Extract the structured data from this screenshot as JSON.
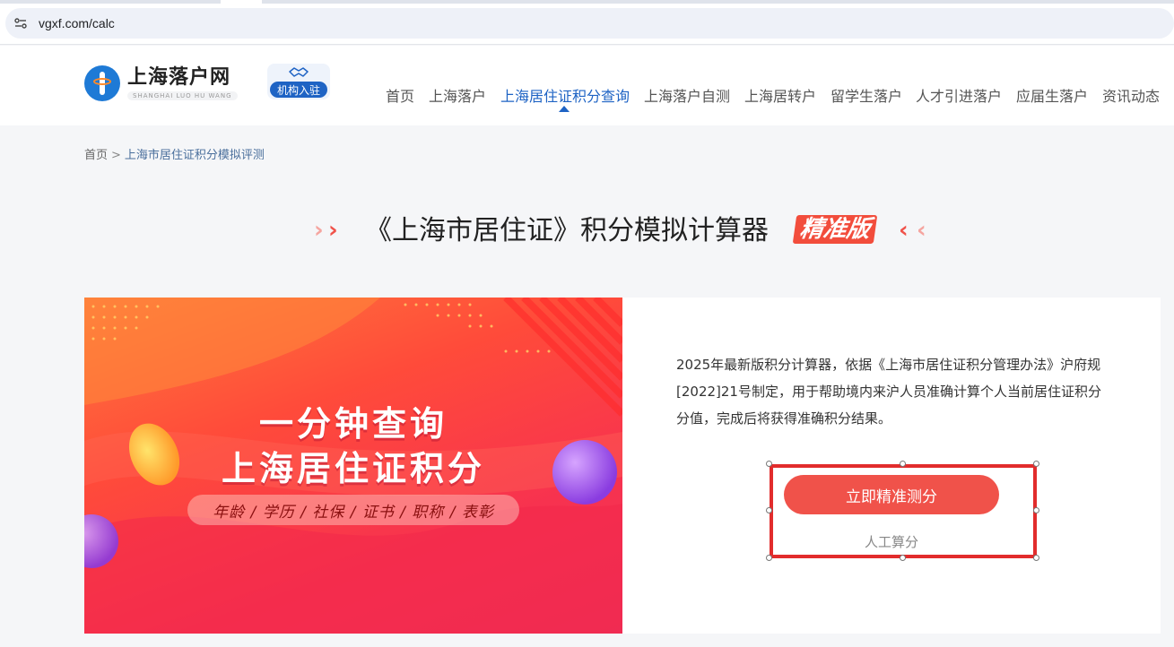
{
  "browser": {
    "url": "vgxf.com/calc"
  },
  "header": {
    "logo_title": "上海落户网",
    "logo_subtitle": "SHANGHAI LUO HU WANG",
    "org_badge": "机构入驻",
    "nav": [
      {
        "label": "首页",
        "active": false
      },
      {
        "label": "上海落户",
        "active": false
      },
      {
        "label": "上海居住证积分查询",
        "active": true
      },
      {
        "label": "上海落户自测",
        "active": false
      },
      {
        "label": "上海居转户",
        "active": false
      },
      {
        "label": "留学生落户",
        "active": false
      },
      {
        "label": "人才引进落户",
        "active": false
      },
      {
        "label": "应届生落户",
        "active": false
      },
      {
        "label": "资讯动态",
        "active": false
      }
    ]
  },
  "breadcrumb": {
    "home": "首页",
    "separator": ">",
    "current": "上海市居住证积分模拟评测"
  },
  "title": {
    "text": "《上海市居住证》积分模拟计算器",
    "badge": "精准版"
  },
  "banner": {
    "line1": "一分钟查询",
    "line2": "上海居住证积分",
    "tags": "年龄 / 学历 / 社保 / 证书 / 职称 / 表彰"
  },
  "description": "2025年最新版积分计算器，依据《上海市居住证积分管理办法》沪府规[2022]21号制定，用于帮助境内来沪人员准确计算个人当前居住证积分分值，完成后将获得准确积分结果。",
  "actions": {
    "primary": "立即精准测分",
    "secondary": "人工算分"
  },
  "colors": {
    "accent": "#1e63c4",
    "brand_red": "#f0524a",
    "selection": "#e22c2c"
  },
  "icons": [
    "site-info-icon",
    "logo-icon",
    "handshake-icon",
    "chevron-right-icon",
    "chevron-left-icon"
  ]
}
